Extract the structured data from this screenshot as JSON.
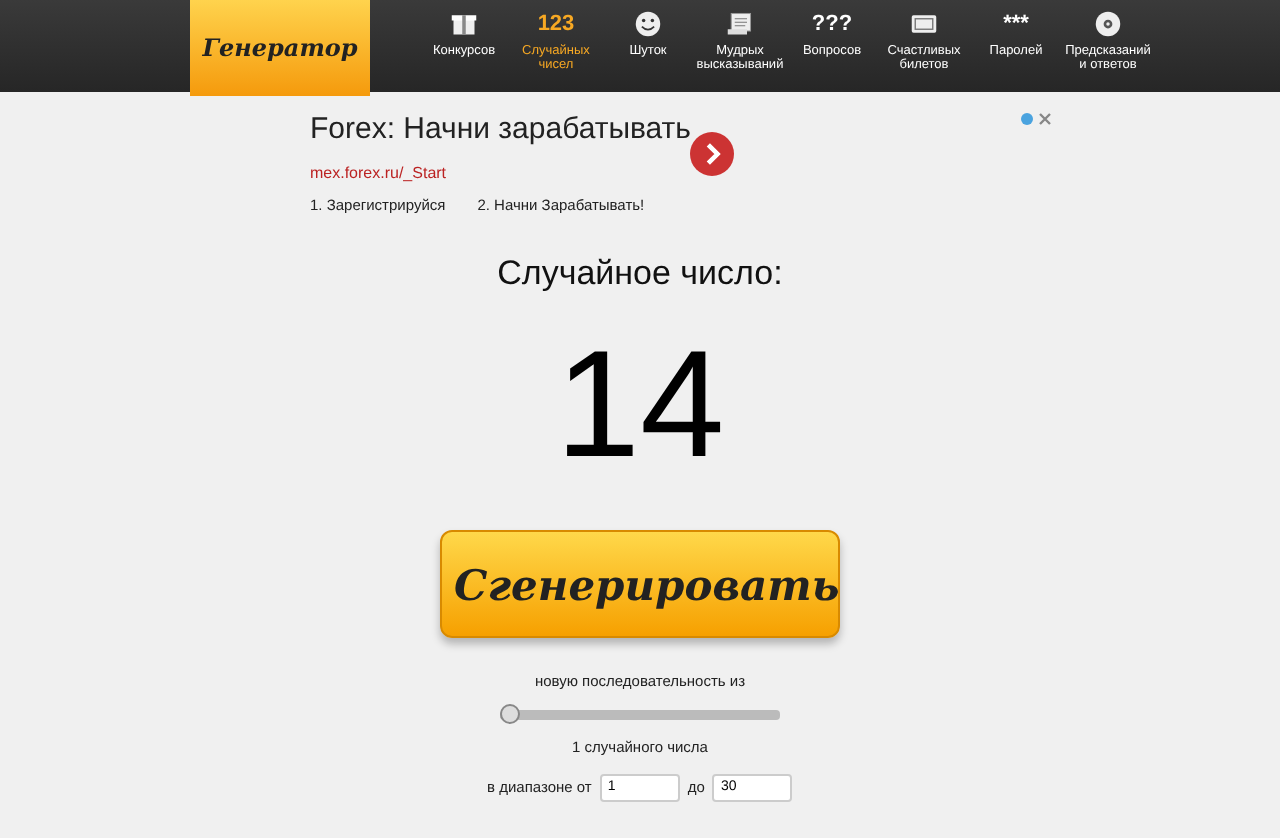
{
  "logo": "Генератор",
  "nav": [
    {
      "kind": "gift",
      "label": "Конкурсов",
      "selected": false
    },
    {
      "kind": "glyph",
      "glyph": "123",
      "label": "Случайных чисел",
      "selected": true
    },
    {
      "kind": "smiley",
      "label": "Шуток",
      "selected": false
    },
    {
      "kind": "scroll",
      "label": "Мудрых высказываний",
      "selected": false
    },
    {
      "kind": "glyph",
      "glyph": "???",
      "label": "Вопросов",
      "selected": false
    },
    {
      "kind": "ticket",
      "label": "Счастливых билетов",
      "selected": false
    },
    {
      "kind": "glyph",
      "glyph": "***",
      "label": "Паролей",
      "selected": false
    },
    {
      "kind": "disc",
      "label": "Предсказаний и ответов",
      "selected": false
    }
  ],
  "ad": {
    "title": "Forex: Начни зарабатывать",
    "url": "mex.forex.ru/_Start",
    "links": [
      "1. Зарегистрируйся",
      "2. Начни Зарабатывать!"
    ]
  },
  "result": {
    "heading": "Случайное число:",
    "number": "14"
  },
  "generate_button": "Сгенерировать",
  "sequence": {
    "label": "новую последовательность из",
    "level": 0,
    "count_text": "1 случайного числа"
  },
  "range": {
    "from_label": "в диапазоне от",
    "from": "1",
    "to_label": "до",
    "to": "30"
  }
}
